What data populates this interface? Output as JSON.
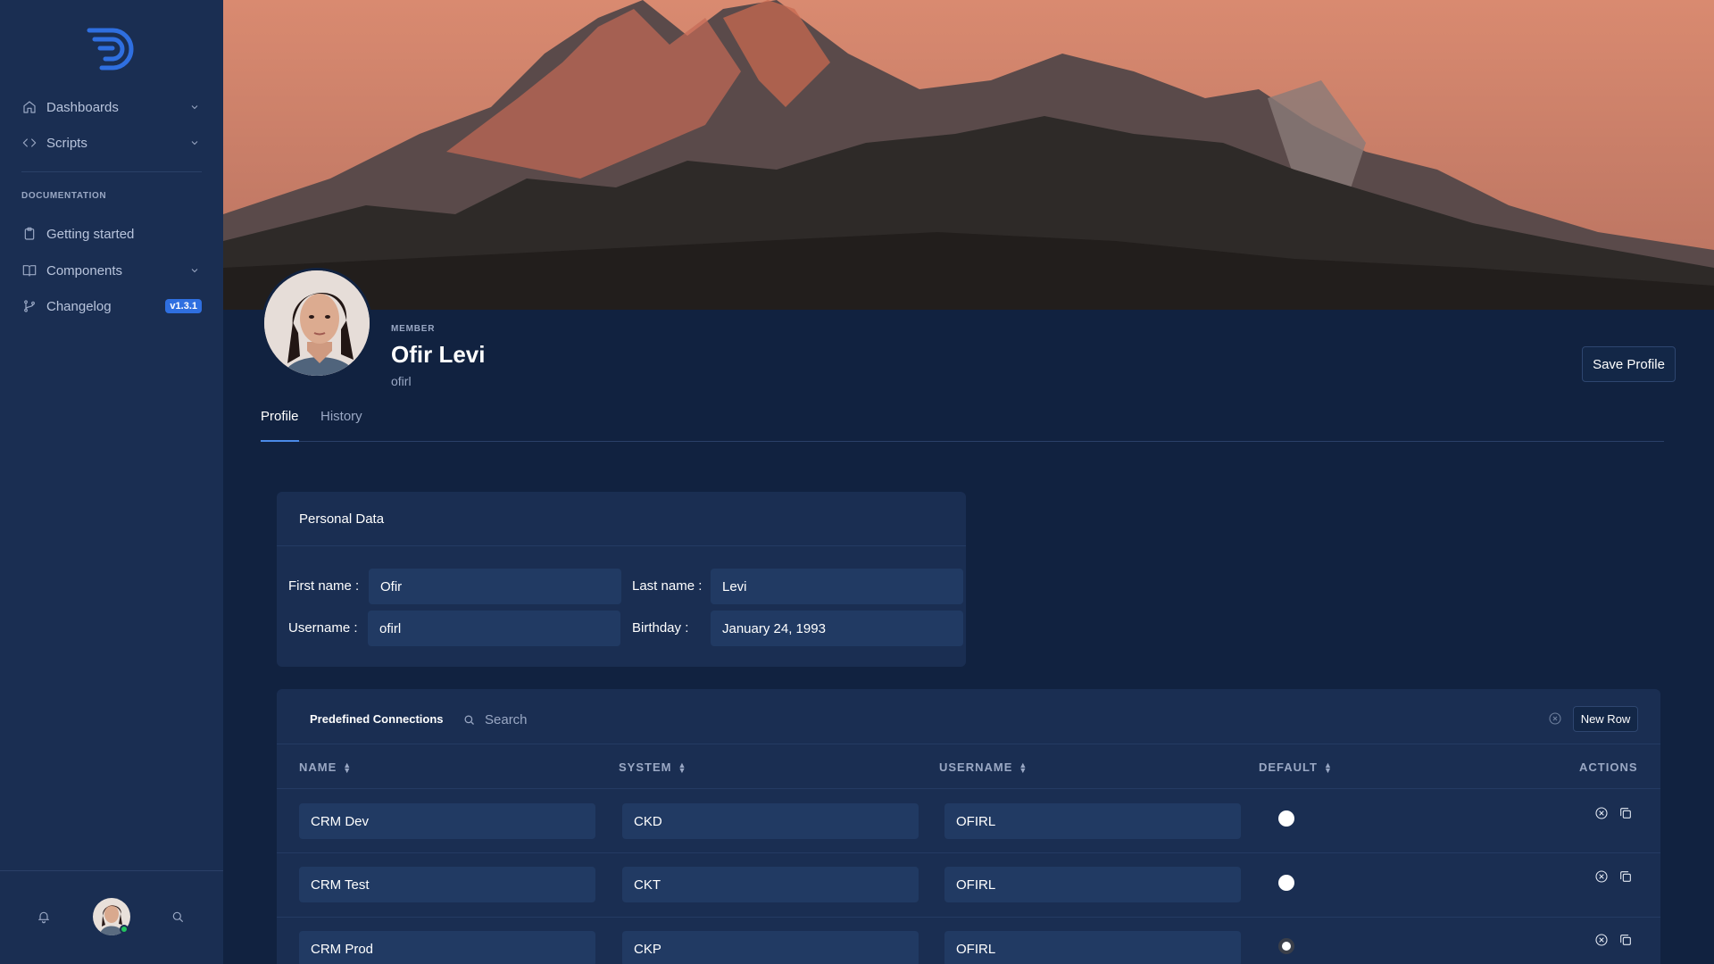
{
  "nav": {
    "items": [
      {
        "label": "Dashboards",
        "icon": "home-icon"
      },
      {
        "label": "Scripts",
        "icon": "code-icon"
      }
    ],
    "section_label": "DOCUMENTATION",
    "doc_items": [
      {
        "label": "Getting started",
        "icon": "clipboard-icon"
      },
      {
        "label": "Components",
        "icon": "book-icon"
      },
      {
        "label": "Changelog",
        "icon": "git-branch-icon",
        "badge": "v1.3.1"
      }
    ]
  },
  "profile": {
    "member_label": "MEMBER",
    "name": "Ofir Levi",
    "username": "ofirl",
    "save_label": "Save Profile",
    "tabs": [
      {
        "label": "Profile",
        "active": true
      },
      {
        "label": "History",
        "active": false
      }
    ]
  },
  "personal": {
    "title": "Personal Data",
    "first_name_label": "First name :",
    "first_name": "Ofir",
    "last_name_label": "Last name :",
    "last_name": "Levi",
    "username_label": "Username :",
    "username": "ofirl",
    "birthday_label": "Birthday :",
    "birthday": "January 24, 1993"
  },
  "connections": {
    "title": "Predefined Connections",
    "search_placeholder": "Search",
    "new_row_label": "New Row",
    "columns": [
      "NAME",
      "SYSTEM",
      "USERNAME",
      "DEFAULT",
      "ACTIONS"
    ],
    "rows": [
      {
        "name": "CRM Dev",
        "system": "CKD",
        "username": "OFIRL",
        "default": false
      },
      {
        "name": "CRM Test",
        "system": "CKT",
        "username": "OFIRL",
        "default": false
      },
      {
        "name": "CRM Prod",
        "system": "CKP",
        "username": "OFIRL",
        "default": true
      }
    ]
  },
  "colors": {
    "sidebar": "#1a2e52",
    "background": "#112240",
    "accent": "#2f6fe0",
    "online": "#22c55e"
  }
}
